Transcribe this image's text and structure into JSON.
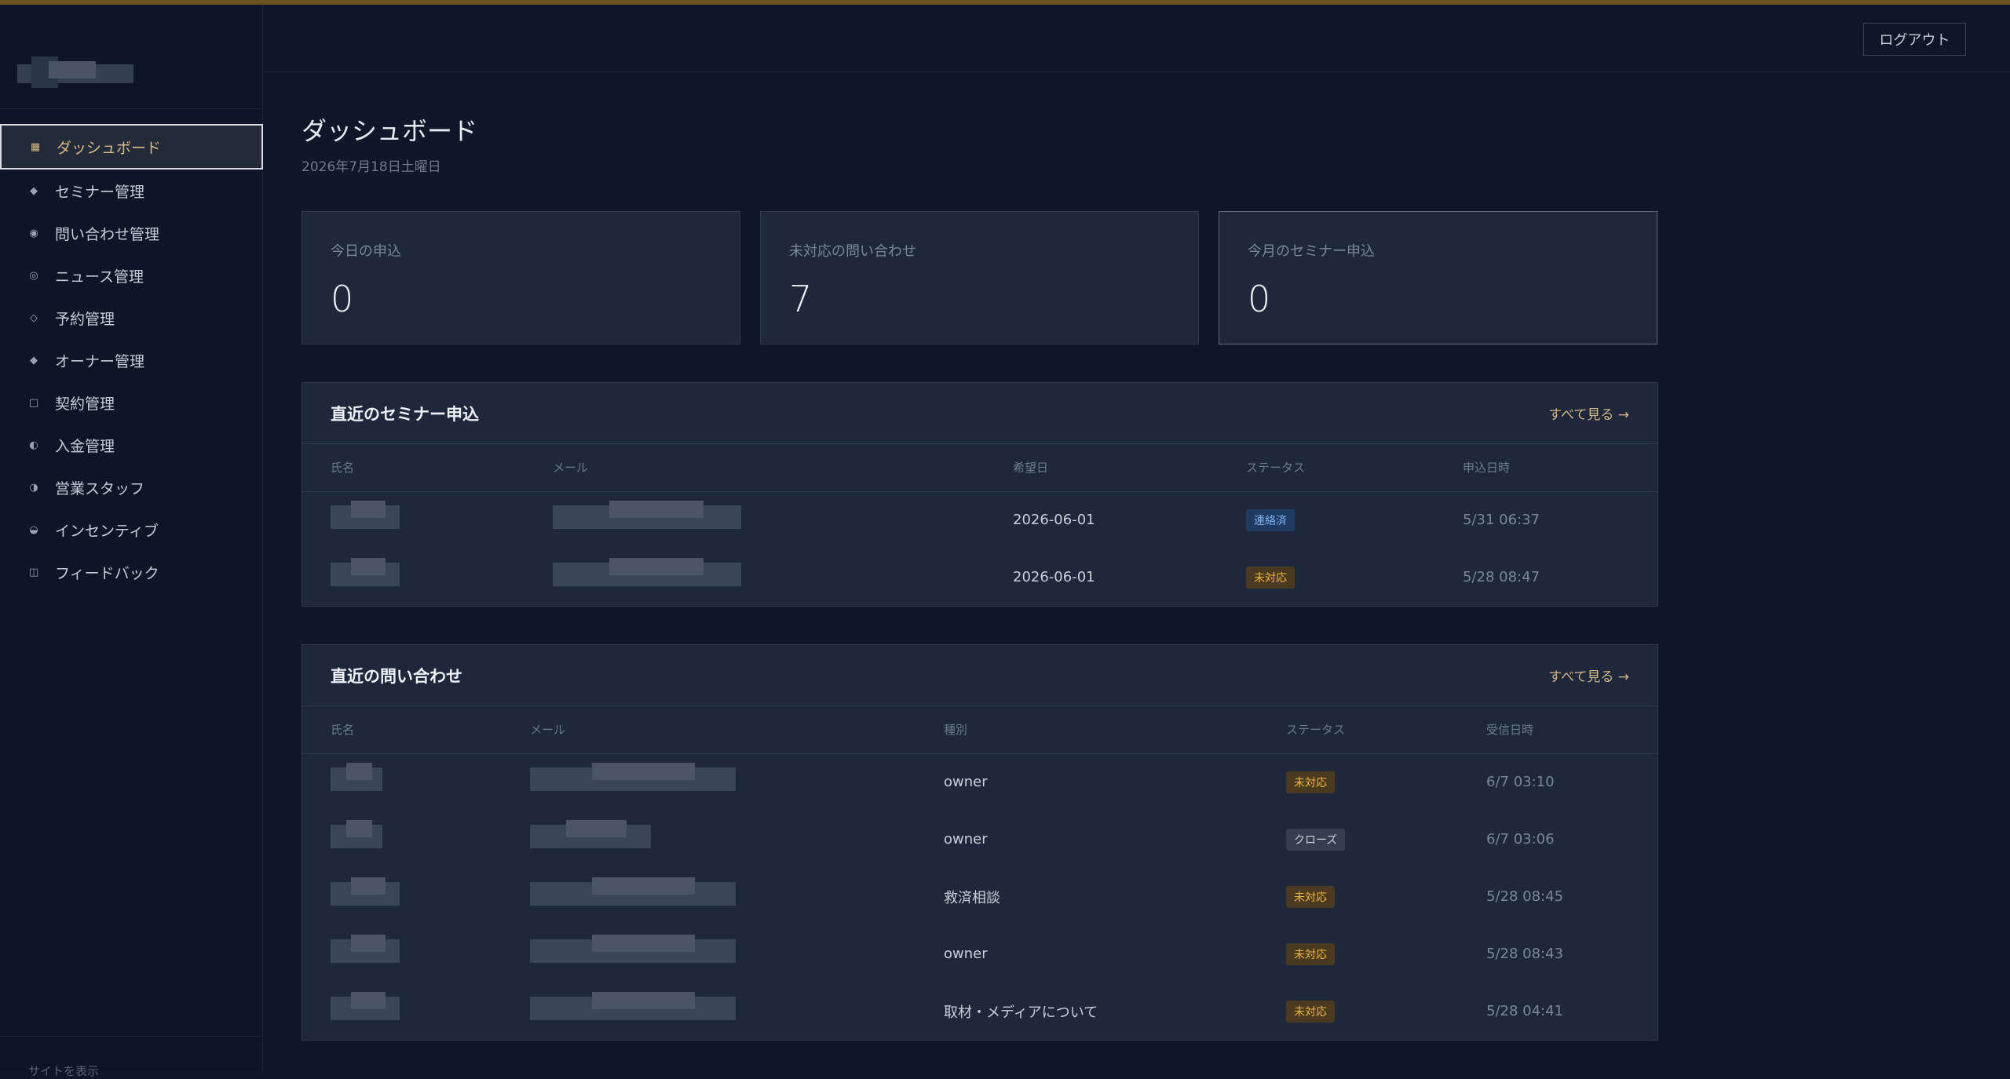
{
  "sidebar": {
    "items": [
      {
        "label": "ダッシュボード",
        "icon": "grid-icon",
        "glyph": "▦",
        "active": true
      },
      {
        "label": "セミナー管理",
        "icon": "diamond-small-icon",
        "glyph": "◆",
        "active": false
      },
      {
        "label": "問い合わせ管理",
        "icon": "circle-dot-icon",
        "glyph": "◉",
        "active": false
      },
      {
        "label": "ニュース管理",
        "icon": "circle-ring-icon",
        "glyph": "◎",
        "active": false
      },
      {
        "label": "予約管理",
        "icon": "diamond-outline-icon",
        "glyph": "◇",
        "active": false
      },
      {
        "label": "オーナー管理",
        "icon": "diamond-small-icon",
        "glyph": "◆",
        "active": false
      },
      {
        "label": "契約管理",
        "icon": "square-outline-icon",
        "glyph": "□",
        "active": false
      },
      {
        "label": "入金管理",
        "icon": "half-circle-icon",
        "glyph": "◐",
        "active": false
      },
      {
        "label": "営業スタッフ",
        "icon": "half-circle-right-icon",
        "glyph": "◑",
        "active": false
      },
      {
        "label": "インセンティブ",
        "icon": "half-circle-bottom-icon",
        "glyph": "◒",
        "active": false
      },
      {
        "label": "フィードバック",
        "icon": "columns-icon",
        "glyph": "◫",
        "active": false
      }
    ],
    "footer": "サイトを表示"
  },
  "header": {
    "logout_label": "ログアウト"
  },
  "page": {
    "title": "ダッシュボード",
    "date": "2026年7月18日土曜日"
  },
  "stats": [
    {
      "label": "今日の申込",
      "value": "0"
    },
    {
      "label": "未対応の問い合わせ",
      "value": "7"
    },
    {
      "label": "今月のセミナー申込",
      "value": "0"
    }
  ],
  "seminar_panel": {
    "title": "直近のセミナー申込",
    "see_all": "すべて見る →",
    "columns": [
      "氏名",
      "メール",
      "希望日",
      "ステータス",
      "申込日時"
    ],
    "rows": [
      {
        "date": "2026-06-01",
        "status": "連絡済",
        "status_type": "contacted",
        "time": "5/31 06:37"
      },
      {
        "date": "2026-06-01",
        "status": "未対応",
        "status_type": "open",
        "time": "5/28 08:47"
      }
    ]
  },
  "inquiry_panel": {
    "title": "直近の問い合わせ",
    "see_all": "すべて見る →",
    "columns": [
      "氏名",
      "メール",
      "種別",
      "ステータス",
      "受信日時"
    ],
    "rows": [
      {
        "kind": "owner",
        "status": "未対応",
        "status_type": "open",
        "time": "6/7 03:10"
      },
      {
        "kind": "owner",
        "status": "クローズ",
        "status_type": "closed",
        "time": "6/7 03:06"
      },
      {
        "kind": "救済相談",
        "status": "未対応",
        "status_type": "open",
        "time": "5/28 08:45"
      },
      {
        "kind": "owner",
        "status": "未対応",
        "status_type": "open",
        "time": "5/28 08:43"
      },
      {
        "kind": "取材・メディアについて",
        "status": "未対応",
        "status_type": "open",
        "time": "5/28 04:41"
      }
    ]
  },
  "colors": {
    "accent": "#d9b989",
    "badge_open": "#f0b440",
    "badge_contacted": "#7fb2ee"
  }
}
